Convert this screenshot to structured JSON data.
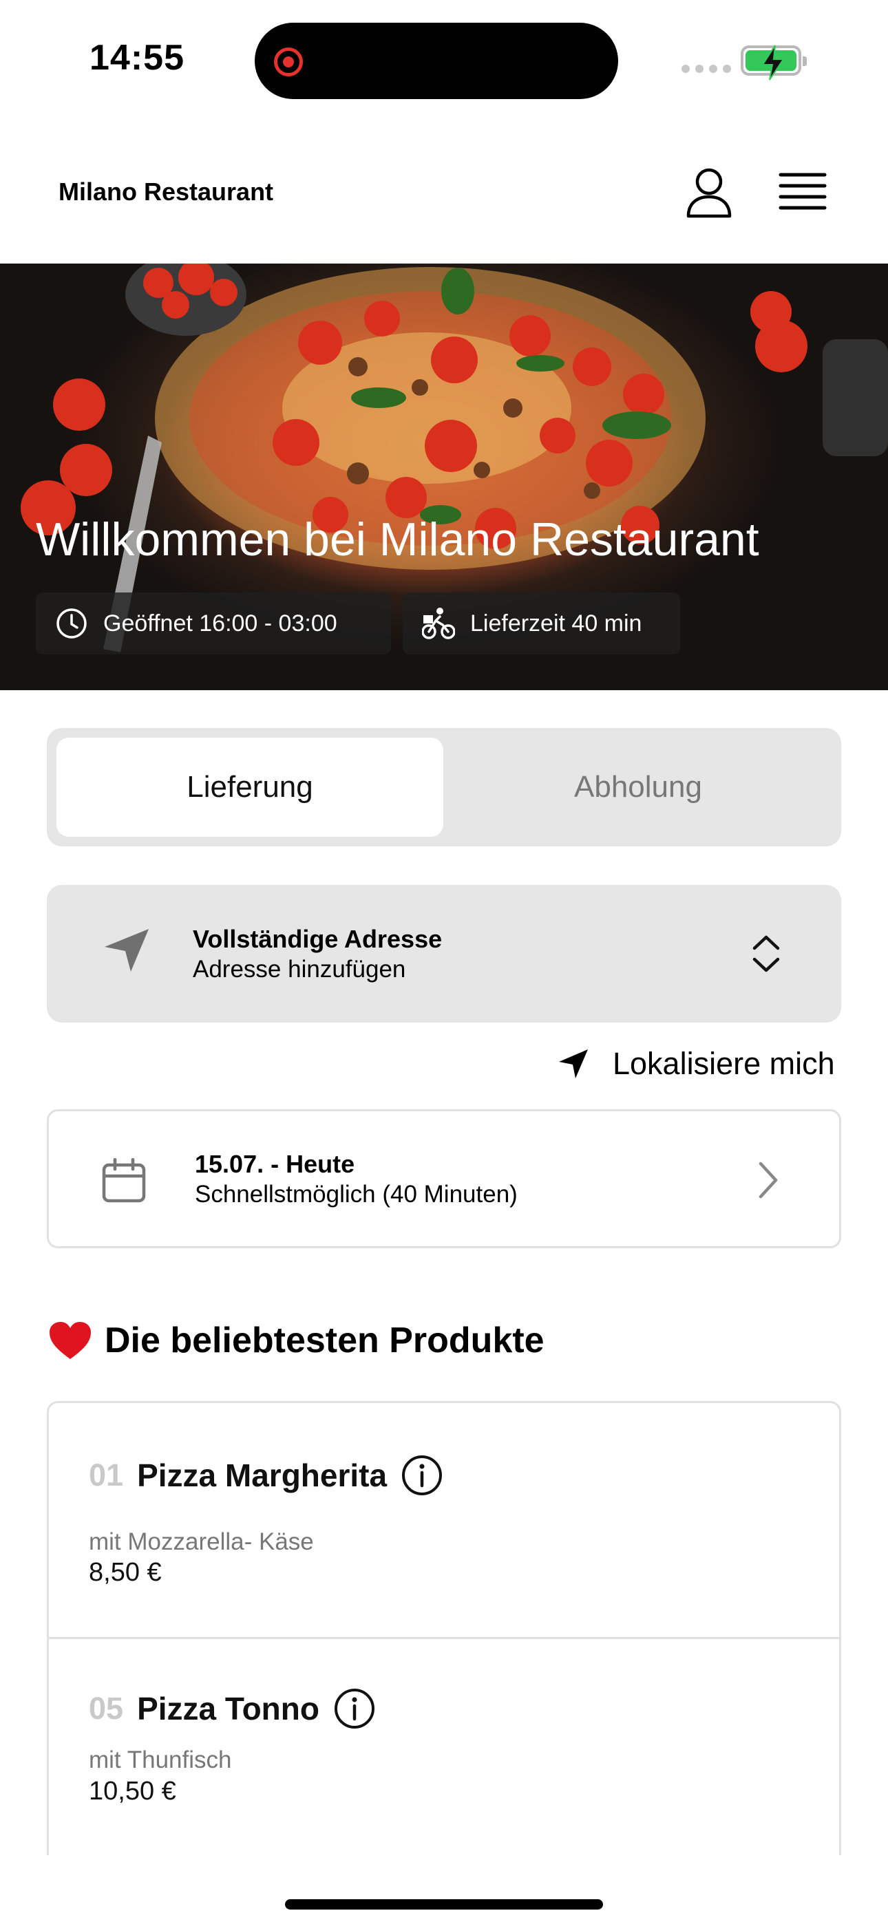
{
  "status_bar": {
    "time": "14:55"
  },
  "header": {
    "title": "Milano Restaurant"
  },
  "hero": {
    "title": "Willkommen bei Milano Restaurant",
    "opening_hours": "Geöffnet 16:00 - 03:00",
    "delivery_time": "Lieferzeit 40 min"
  },
  "order_mode": {
    "tabs": [
      {
        "label": "Lieferung",
        "selected": true
      },
      {
        "label": "Abholung",
        "selected": false
      }
    ]
  },
  "address": {
    "title": "Vollständige Adresse",
    "subtitle": "Adresse hinzufügen"
  },
  "locate_label": "Lokalisiere mich",
  "schedule": {
    "date": "15.07. - Heute",
    "time": "Schnellstmöglich (40 Minuten)"
  },
  "popular": {
    "emoji": "❤️",
    "title": "Die beliebtesten Produkte",
    "items": [
      {
        "number": "01",
        "name": "Pizza Margherita",
        "description": "mit Mozzarella- Käse",
        "price": "8,50 €"
      },
      {
        "number": "05",
        "name": "Pizza Tonno",
        "description": "mit Thunfisch",
        "price": "10,50 €"
      }
    ]
  },
  "colors": {
    "accent": "#34c759",
    "record": "#e5322d",
    "panel": "#e6e6e6"
  }
}
